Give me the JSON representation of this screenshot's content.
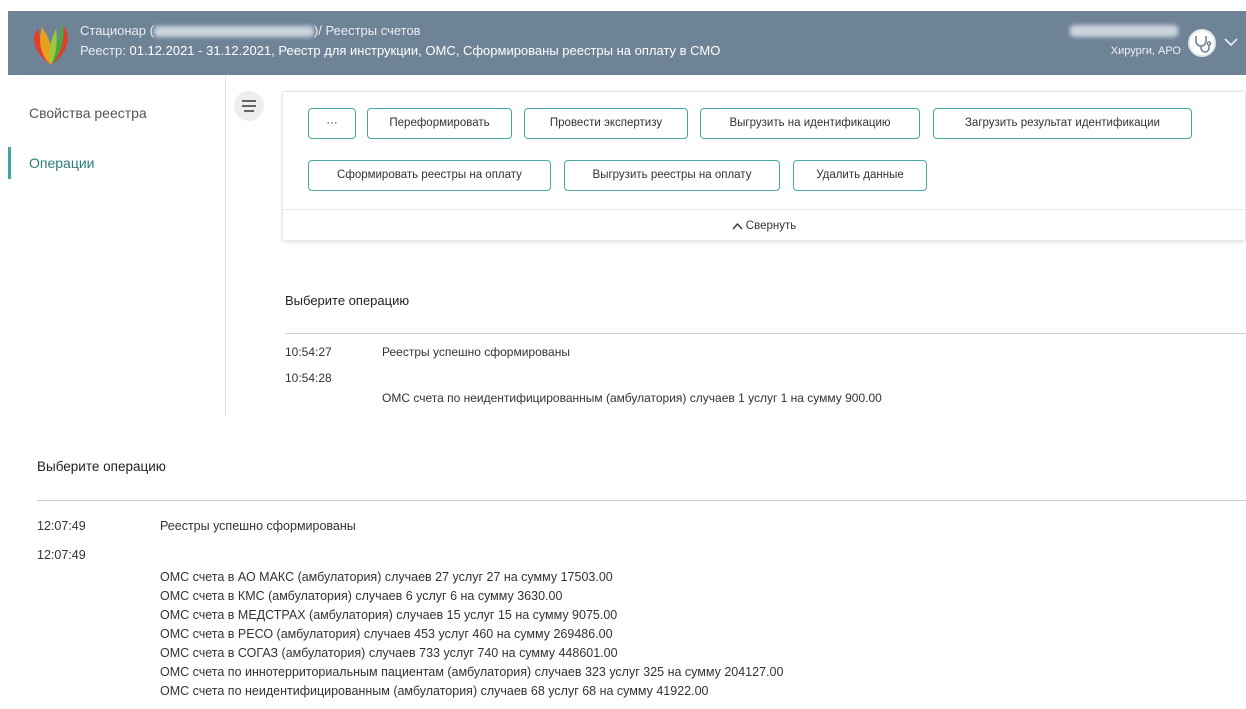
{
  "header": {
    "line1_prefix": "Стационар (",
    "line1_suffix": ")/ Реестры счетов",
    "line2_label": "Реестр: ",
    "line2_value": "01.12.2021 - 31.12.2021, Реестр для инструкции, ОМС, Сформированы реестры на оплату в СМО",
    "user_role": "Хирурги, АРО",
    "brand_colors": {
      "header_bg": "#6f8397",
      "accent": "#3fa7a2"
    }
  },
  "sidebar": {
    "items": [
      {
        "label": "Свойства реестра",
        "active": false
      },
      {
        "label": "Операции",
        "active": true
      }
    ]
  },
  "panel": {
    "more_label": "···",
    "buttons": [
      "Переформировать",
      "Провести экспертизу",
      "Выгрузить на идентификацию",
      "Загрузить результат идентификации",
      "Сформировать реестры на оплату",
      "Выгрузить реестры на оплату",
      "Удалить данные"
    ],
    "collapse_label": "Свернуть"
  },
  "operations_top": {
    "title": "Выберите операцию",
    "log": [
      {
        "time": "10:54:27",
        "message": "Реестры успешно сформированы"
      },
      {
        "time": "10:54:28",
        "message": ""
      }
    ],
    "detail": "ОМС счета по неидентифицированным (амбулатория) случаев 1 услуг 1 на сумму 900.00"
  },
  "operations_bottom": {
    "title": "Выберите операцию",
    "log": [
      {
        "time": "12:07:49",
        "message": "Реестры успешно сформированы"
      },
      {
        "time": "12:07:49",
        "message": ""
      }
    ],
    "details": [
      "ОМС счета в АО МАКС (амбулатория) случаев 27 услуг 27 на сумму 17503.00",
      "ОМС счета в КМС (амбулатория) случаев 6 услуг 6 на сумму 3630.00",
      "ОМС счета в МЕДСТРАХ (амбулатория) случаев 15 услуг 15 на сумму 9075.00",
      "ОМС счета в РЕСО (амбулатория) случаев 453 услуг 460 на сумму 269486.00",
      "ОМС счета в СОГАЗ (амбулатория) случаев 733 услуг 740 на сумму 448601.00",
      "ОМС счета по иннотерриториальным пациентам (амбулатория) случаев 323 услуг 325 на сумму 204127.00",
      "ОМС счета по неидентифицированным (амбулатория) случаев 68 услуг 68 на сумму 41922.00"
    ]
  }
}
